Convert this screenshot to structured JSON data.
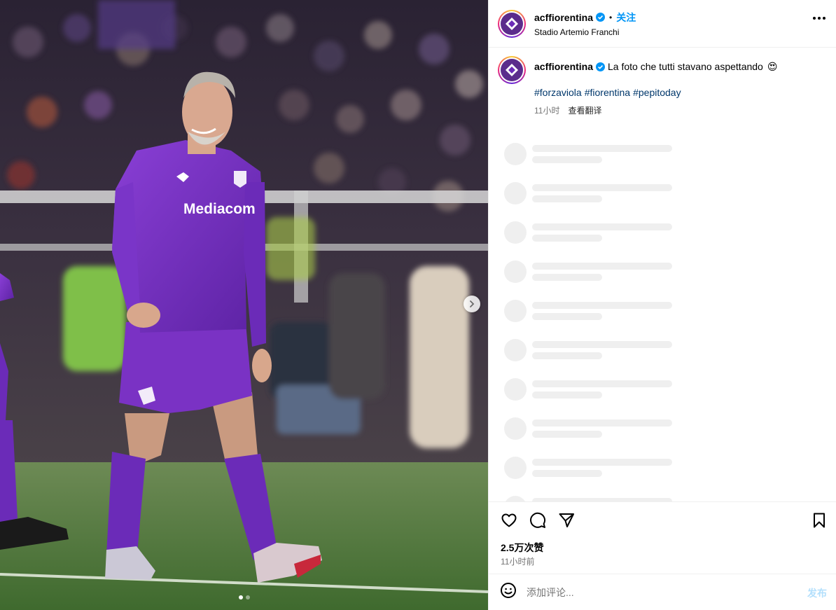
{
  "header": {
    "username": "acffiorentina",
    "verified": true,
    "separator": "•",
    "follow_label": "关注",
    "location": "Stadio Artemio Franchi",
    "more_icon": "more-horizontal-icon"
  },
  "caption": {
    "username": "acffiorentina",
    "text": "La foto che tutti stavano aspettando",
    "emoji": "😍",
    "hashtags": [
      "#forzaviola",
      "#fiorentina",
      "#pepitoday"
    ],
    "time": "11小时",
    "translate_label": "查看翻译"
  },
  "actions": {
    "like_icon": "heart-icon",
    "comment_icon": "comment-icon",
    "share_icon": "share-icon",
    "save_icon": "bookmark-icon",
    "likes_text": "2.5万次赞",
    "time_text": "11小时前"
  },
  "comment": {
    "emoji_icon": "smiley-icon",
    "placeholder": "添加评论...",
    "post_label": "发布"
  },
  "media": {
    "jersey_sponsor": "Mediacom",
    "kit_brand": "Kappa",
    "slide_count": 2,
    "active_slide": 1
  },
  "colors": {
    "accent": "#0095f6",
    "fiorentina_purple": "#6b2bb8",
    "hashtag": "#00376b",
    "muted": "#737373"
  }
}
